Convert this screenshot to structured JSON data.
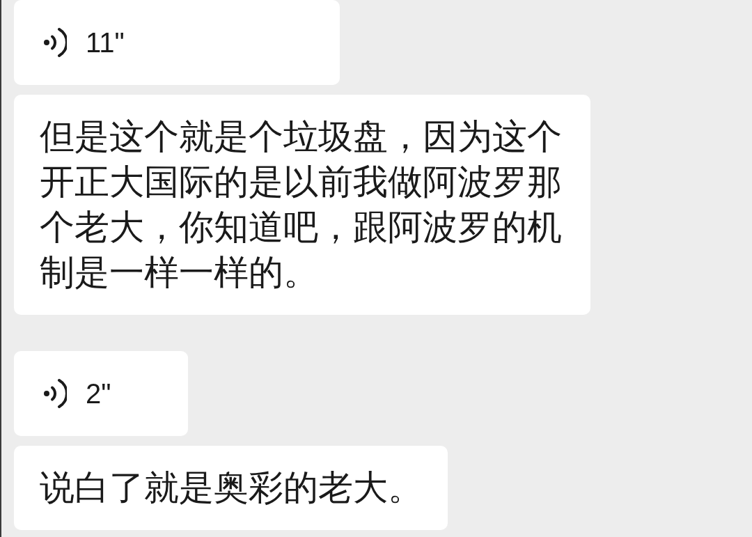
{
  "chat": {
    "groups": [
      {
        "messages": [
          {
            "kind": "voice",
            "duration": "11\""
          },
          {
            "kind": "text",
            "text": "但是这个就是个垃圾盘，因为这个开正大国际的是以前我做阿波罗那个老大，你知道吧，跟阿波罗的机制是一样一样的。"
          }
        ]
      },
      {
        "messages": [
          {
            "kind": "voice",
            "duration": "2\""
          },
          {
            "kind": "text",
            "text": "说白了就是奥彩的老大。"
          }
        ]
      }
    ]
  }
}
